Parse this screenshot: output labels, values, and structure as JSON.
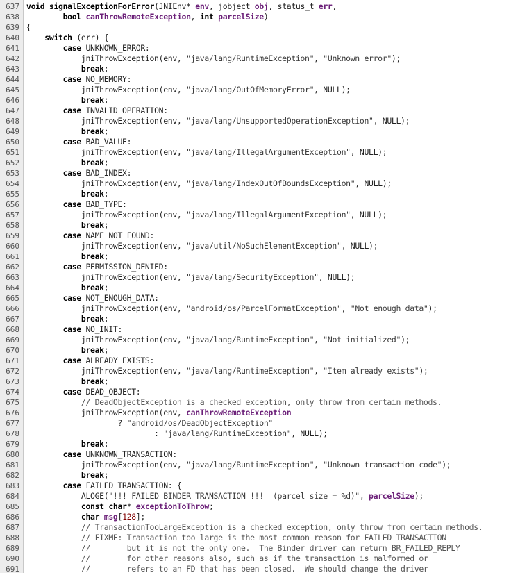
{
  "lines": [
    {
      "n": "637",
      "tokens": [
        [
          "kw",
          "void"
        ],
        [
          "p",
          " "
        ],
        [
          "fn",
          "signalExceptionForError"
        ],
        [
          "p",
          "(JNIEnv* "
        ],
        [
          "pm",
          "env"
        ],
        [
          "p",
          ", jobject "
        ],
        [
          "pm",
          "obj"
        ],
        [
          "p",
          ", status_t "
        ],
        [
          "pm",
          "err"
        ],
        [
          "p",
          ","
        ]
      ]
    },
    {
      "n": "638",
      "tokens": [
        [
          "p",
          "        "
        ],
        [
          "kw",
          "bool"
        ],
        [
          "p",
          " "
        ],
        [
          "pm",
          "canThrowRemoteException"
        ],
        [
          "p",
          ", "
        ],
        [
          "kw",
          "int"
        ],
        [
          "p",
          " "
        ],
        [
          "pm",
          "parcelSize"
        ],
        [
          "p",
          ")"
        ]
      ]
    },
    {
      "n": "639",
      "tokens": [
        [
          "p",
          "{"
        ]
      ]
    },
    {
      "n": "640",
      "tokens": [
        [
          "p",
          "    "
        ],
        [
          "kw",
          "switch"
        ],
        [
          "p",
          " (err) {"
        ]
      ]
    },
    {
      "n": "641",
      "tokens": [
        [
          "p",
          "        "
        ],
        [
          "kw",
          "case"
        ],
        [
          "p",
          " UNKNOWN_ERROR:"
        ]
      ]
    },
    {
      "n": "642",
      "tokens": [
        [
          "p",
          "            jniThrowException(env, "
        ],
        [
          "str",
          "\"java/lang/RuntimeException\""
        ],
        [
          "p",
          ", "
        ],
        [
          "str",
          "\"Unknown error\""
        ],
        [
          "p",
          ");"
        ]
      ]
    },
    {
      "n": "643",
      "tokens": [
        [
          "p",
          "            "
        ],
        [
          "kw",
          "break"
        ],
        [
          "p",
          ";"
        ]
      ]
    },
    {
      "n": "644",
      "tokens": [
        [
          "p",
          "        "
        ],
        [
          "kw",
          "case"
        ],
        [
          "p",
          " NO_MEMORY:"
        ]
      ]
    },
    {
      "n": "645",
      "tokens": [
        [
          "p",
          "            jniThrowException(env, "
        ],
        [
          "str",
          "\"java/lang/OutOfMemoryError\""
        ],
        [
          "p",
          ", NULL);"
        ]
      ]
    },
    {
      "n": "646",
      "tokens": [
        [
          "p",
          "            "
        ],
        [
          "kw",
          "break"
        ],
        [
          "p",
          ";"
        ]
      ]
    },
    {
      "n": "647",
      "tokens": [
        [
          "p",
          "        "
        ],
        [
          "kw",
          "case"
        ],
        [
          "p",
          " INVALID_OPERATION:"
        ]
      ]
    },
    {
      "n": "648",
      "tokens": [
        [
          "p",
          "            jniThrowException(env, "
        ],
        [
          "str",
          "\"java/lang/UnsupportedOperationException\""
        ],
        [
          "p",
          ", NULL);"
        ]
      ]
    },
    {
      "n": "649",
      "tokens": [
        [
          "p",
          "            "
        ],
        [
          "kw",
          "break"
        ],
        [
          "p",
          ";"
        ]
      ]
    },
    {
      "n": "650",
      "tokens": [
        [
          "p",
          "        "
        ],
        [
          "kw",
          "case"
        ],
        [
          "p",
          " BAD_VALUE:"
        ]
      ]
    },
    {
      "n": "651",
      "tokens": [
        [
          "p",
          "            jniThrowException(env, "
        ],
        [
          "str",
          "\"java/lang/IllegalArgumentException\""
        ],
        [
          "p",
          ", NULL);"
        ]
      ]
    },
    {
      "n": "652",
      "tokens": [
        [
          "p",
          "            "
        ],
        [
          "kw",
          "break"
        ],
        [
          "p",
          ";"
        ]
      ]
    },
    {
      "n": "653",
      "tokens": [
        [
          "p",
          "        "
        ],
        [
          "kw",
          "case"
        ],
        [
          "p",
          " BAD_INDEX:"
        ]
      ]
    },
    {
      "n": "654",
      "tokens": [
        [
          "p",
          "            jniThrowException(env, "
        ],
        [
          "str",
          "\"java/lang/IndexOutOfBoundsException\""
        ],
        [
          "p",
          ", NULL);"
        ]
      ]
    },
    {
      "n": "655",
      "tokens": [
        [
          "p",
          "            "
        ],
        [
          "kw",
          "break"
        ],
        [
          "p",
          ";"
        ]
      ]
    },
    {
      "n": "656",
      "tokens": [
        [
          "p",
          "        "
        ],
        [
          "kw",
          "case"
        ],
        [
          "p",
          " BAD_TYPE:"
        ]
      ]
    },
    {
      "n": "657",
      "tokens": [
        [
          "p",
          "            jniThrowException(env, "
        ],
        [
          "str",
          "\"java/lang/IllegalArgumentException\""
        ],
        [
          "p",
          ", NULL);"
        ]
      ]
    },
    {
      "n": "658",
      "tokens": [
        [
          "p",
          "            "
        ],
        [
          "kw",
          "break"
        ],
        [
          "p",
          ";"
        ]
      ]
    },
    {
      "n": "659",
      "tokens": [
        [
          "p",
          "        "
        ],
        [
          "kw",
          "case"
        ],
        [
          "p",
          " NAME_NOT_FOUND:"
        ]
      ]
    },
    {
      "n": "660",
      "tokens": [
        [
          "p",
          "            jniThrowException(env, "
        ],
        [
          "str",
          "\"java/util/NoSuchElementException\""
        ],
        [
          "p",
          ", NULL);"
        ]
      ]
    },
    {
      "n": "661",
      "tokens": [
        [
          "p",
          "            "
        ],
        [
          "kw",
          "break"
        ],
        [
          "p",
          ";"
        ]
      ]
    },
    {
      "n": "662",
      "tokens": [
        [
          "p",
          "        "
        ],
        [
          "kw",
          "case"
        ],
        [
          "p",
          " PERMISSION_DENIED:"
        ]
      ]
    },
    {
      "n": "663",
      "tokens": [
        [
          "p",
          "            jniThrowException(env, "
        ],
        [
          "str",
          "\"java/lang/SecurityException\""
        ],
        [
          "p",
          ", NULL);"
        ]
      ]
    },
    {
      "n": "664",
      "tokens": [
        [
          "p",
          "            "
        ],
        [
          "kw",
          "break"
        ],
        [
          "p",
          ";"
        ]
      ]
    },
    {
      "n": "665",
      "tokens": [
        [
          "p",
          "        "
        ],
        [
          "kw",
          "case"
        ],
        [
          "p",
          " NOT_ENOUGH_DATA:"
        ]
      ]
    },
    {
      "n": "666",
      "tokens": [
        [
          "p",
          "            jniThrowException(env, "
        ],
        [
          "str",
          "\"android/os/ParcelFormatException\""
        ],
        [
          "p",
          ", "
        ],
        [
          "str",
          "\"Not enough data\""
        ],
        [
          "p",
          ");"
        ]
      ]
    },
    {
      "n": "667",
      "tokens": [
        [
          "p",
          "            "
        ],
        [
          "kw",
          "break"
        ],
        [
          "p",
          ";"
        ]
      ]
    },
    {
      "n": "668",
      "tokens": [
        [
          "p",
          "        "
        ],
        [
          "kw",
          "case"
        ],
        [
          "p",
          " NO_INIT:"
        ]
      ]
    },
    {
      "n": "669",
      "tokens": [
        [
          "p",
          "            jniThrowException(env, "
        ],
        [
          "str",
          "\"java/lang/RuntimeException\""
        ],
        [
          "p",
          ", "
        ],
        [
          "str",
          "\"Not initialized\""
        ],
        [
          "p",
          ");"
        ]
      ]
    },
    {
      "n": "670",
      "tokens": [
        [
          "p",
          "            "
        ],
        [
          "kw",
          "break"
        ],
        [
          "p",
          ";"
        ]
      ]
    },
    {
      "n": "671",
      "tokens": [
        [
          "p",
          "        "
        ],
        [
          "kw",
          "case"
        ],
        [
          "p",
          " ALREADY_EXISTS:"
        ]
      ]
    },
    {
      "n": "672",
      "tokens": [
        [
          "p",
          "            jniThrowException(env, "
        ],
        [
          "str",
          "\"java/lang/RuntimeException\""
        ],
        [
          "p",
          ", "
        ],
        [
          "str",
          "\"Item already exists\""
        ],
        [
          "p",
          ");"
        ]
      ]
    },
    {
      "n": "673",
      "tokens": [
        [
          "p",
          "            "
        ],
        [
          "kw",
          "break"
        ],
        [
          "p",
          ";"
        ]
      ]
    },
    {
      "n": "674",
      "tokens": [
        [
          "p",
          "        "
        ],
        [
          "kw",
          "case"
        ],
        [
          "p",
          " DEAD_OBJECT:"
        ]
      ]
    },
    {
      "n": "675",
      "tokens": [
        [
          "p",
          "            "
        ],
        [
          "cm",
          "// DeadObjectException is a checked exception, only throw from certain methods."
        ]
      ]
    },
    {
      "n": "676",
      "tokens": [
        [
          "p",
          "            jniThrowException(env, "
        ],
        [
          "pm",
          "canThrowRemoteException"
        ]
      ]
    },
    {
      "n": "677",
      "tokens": [
        [
          "p",
          "                    ? "
        ],
        [
          "str",
          "\"android/os/DeadObjectException\""
        ]
      ]
    },
    {
      "n": "678",
      "tokens": [
        [
          "p",
          "                            : "
        ],
        [
          "str",
          "\"java/lang/RuntimeException\""
        ],
        [
          "p",
          ", NULL);"
        ]
      ]
    },
    {
      "n": "679",
      "tokens": [
        [
          "p",
          "            "
        ],
        [
          "kw",
          "break"
        ],
        [
          "p",
          ";"
        ]
      ]
    },
    {
      "n": "680",
      "tokens": [
        [
          "p",
          "        "
        ],
        [
          "kw",
          "case"
        ],
        [
          "p",
          " UNKNOWN_TRANSACTION:"
        ]
      ]
    },
    {
      "n": "681",
      "tokens": [
        [
          "p",
          "            jniThrowException(env, "
        ],
        [
          "str",
          "\"java/lang/RuntimeException\""
        ],
        [
          "p",
          ", "
        ],
        [
          "str",
          "\"Unknown transaction code\""
        ],
        [
          "p",
          ");"
        ]
      ]
    },
    {
      "n": "682",
      "tokens": [
        [
          "p",
          "            "
        ],
        [
          "kw",
          "break"
        ],
        [
          "p",
          ";"
        ]
      ]
    },
    {
      "n": "683",
      "tokens": [
        [
          "p",
          "        "
        ],
        [
          "kw",
          "case"
        ],
        [
          "p",
          " FAILED_TRANSACTION: {"
        ]
      ]
    },
    {
      "n": "684",
      "tokens": [
        [
          "p",
          "            ALOGE("
        ],
        [
          "str",
          "\"!!! FAILED BINDER TRANSACTION !!!  (parcel size = %d)\""
        ],
        [
          "p",
          ", "
        ],
        [
          "pm",
          "parcelSize"
        ],
        [
          "p",
          ");"
        ]
      ]
    },
    {
      "n": "685",
      "tokens": [
        [
          "p",
          "            "
        ],
        [
          "kw",
          "const char"
        ],
        [
          "p",
          "* "
        ],
        [
          "pm",
          "exceptionToThrow"
        ],
        [
          "p",
          ";"
        ]
      ]
    },
    {
      "n": "686",
      "tokens": [
        [
          "p",
          "            "
        ],
        [
          "kw",
          "char"
        ],
        [
          "p",
          " "
        ],
        [
          "pm",
          "msg"
        ],
        [
          "p",
          "["
        ],
        [
          "nm",
          "128"
        ],
        [
          "p",
          "];"
        ]
      ]
    },
    {
      "n": "687",
      "tokens": [
        [
          "p",
          "            "
        ],
        [
          "cm",
          "// TransactionTooLargeException is a checked exception, only throw from certain methods."
        ]
      ]
    },
    {
      "n": "688",
      "tokens": [
        [
          "p",
          "            "
        ],
        [
          "cm",
          "// FIXME: Transaction too large is the most common reason for FAILED_TRANSACTION"
        ]
      ]
    },
    {
      "n": "689",
      "tokens": [
        [
          "p",
          "            "
        ],
        [
          "cm",
          "//        but it is not the only one.  The Binder driver can return BR_FAILED_REPLY"
        ]
      ]
    },
    {
      "n": "690",
      "tokens": [
        [
          "p",
          "            "
        ],
        [
          "cm",
          "//        for other reasons also, such as if the transaction is malformed or"
        ]
      ]
    },
    {
      "n": "691",
      "tokens": [
        [
          "p",
          "            "
        ],
        [
          "cm",
          "//        refers to an FD that has been closed.  We should change the driver"
        ]
      ]
    }
  ]
}
